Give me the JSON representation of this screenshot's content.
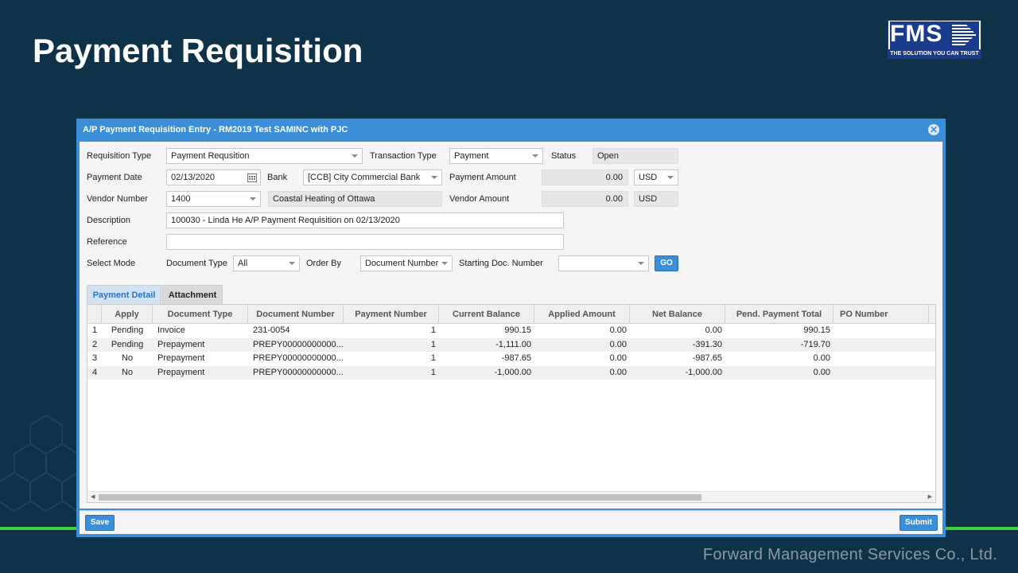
{
  "slide": {
    "title": "Payment Requisition",
    "company": "Forward Management  Services Co., Ltd.",
    "logo_text": "FMS",
    "logo_tagline": "THE SOLUTION YOU CAN TRUST"
  },
  "window": {
    "title": "A/P Payment Requisition Entry - RM2019 Test SAMINC with PJC",
    "close_glyph": "✕"
  },
  "form": {
    "requisition_type": {
      "label": "Requisition Type",
      "value": "Payment Requsition"
    },
    "transaction_type": {
      "label": "Transaction Type",
      "value": "Payment"
    },
    "status": {
      "label": "Status",
      "value": "Open"
    },
    "payment_date": {
      "label": "Payment Date",
      "value": "02/13/2020"
    },
    "bank": {
      "label": "Bank",
      "value": "[CCB] City Commercial Bank"
    },
    "payment_amount": {
      "label": "Payment Amount",
      "value": "0.00",
      "currency": "USD"
    },
    "vendor_number": {
      "label": "Vendor Number",
      "value": "1400",
      "name": "Coastal Heating of Ottawa"
    },
    "vendor_amount": {
      "label": "Vendor Amount",
      "value": "0.00",
      "currency": "USD"
    },
    "description": {
      "label": "Description",
      "value": "100030 - Linda He A/P Payment Requisition on 02/13/2020"
    },
    "reference": {
      "label": "Reference",
      "value": ""
    },
    "select_mode": {
      "label": "Select Mode"
    },
    "document_type": {
      "label": "Document Type",
      "value": "All"
    },
    "order_by": {
      "label": "Order By",
      "value": "Document Number"
    },
    "starting_doc": {
      "label": "Starting Doc. Number",
      "value": ""
    },
    "go_label": "GO"
  },
  "tabs": [
    {
      "label": "Payment Detail",
      "active": true
    },
    {
      "label": "Attachment",
      "active": false
    }
  ],
  "grid": {
    "columns": [
      "",
      "Apply",
      "Document Type",
      "Document Number",
      "Payment Number",
      "Current Balance",
      "Applied Amount",
      "Net Balance",
      "Pend. Payment Total",
      "PO Number"
    ],
    "rows": [
      [
        "1",
        "Pending",
        "Invoice",
        "231-0054",
        "1",
        "990.15",
        "0.00",
        "0.00",
        "990.15",
        ""
      ],
      [
        "2",
        "Pending",
        "Prepayment",
        "PREPY00000000000...",
        "1",
        "-1,111.00",
        "0.00",
        "-391.30",
        "-719.70",
        ""
      ],
      [
        "3",
        "No",
        "Prepayment",
        "PREPY00000000000...",
        "1",
        "-987.65",
        "0.00",
        "-987.65",
        "0.00",
        ""
      ],
      [
        "4",
        "No",
        "Prepayment",
        "PREPY00000000000...",
        "1",
        "-1,000.00",
        "0.00",
        "-1,000.00",
        "0.00",
        ""
      ]
    ]
  },
  "footer": {
    "save_label": "Save",
    "submit_label": "Submit"
  },
  "colors": {
    "background": "#0e3349",
    "accent": "#3a8fd8",
    "green_rule": "#3bd23b"
  }
}
